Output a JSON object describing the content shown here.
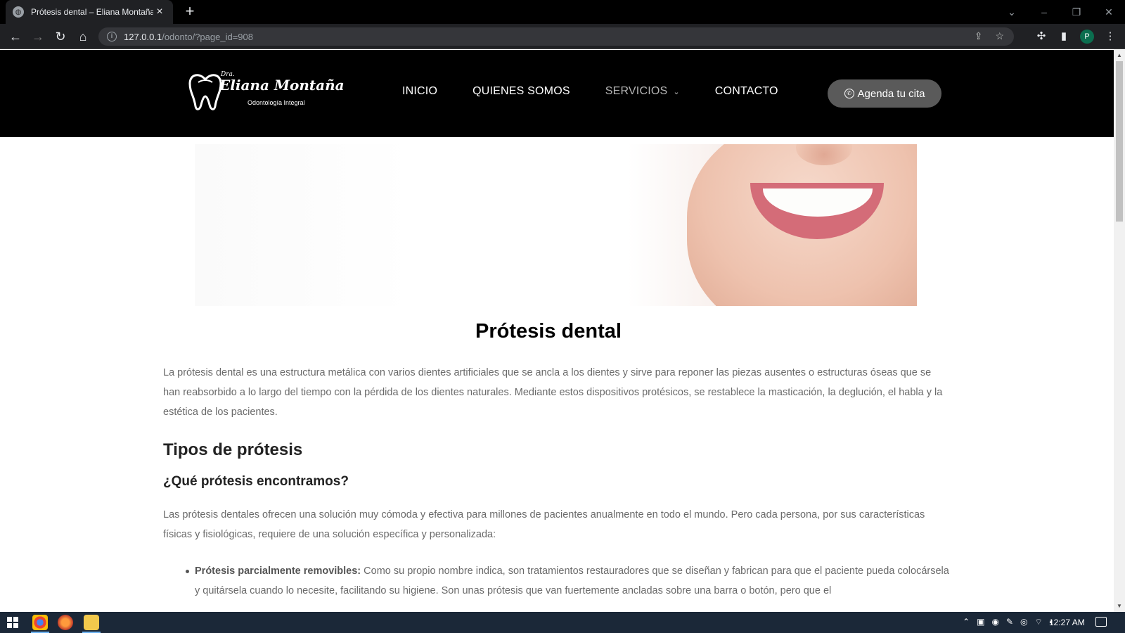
{
  "browser": {
    "tab_title": "Prótesis dental – Eliana Montaña",
    "url_host": "127.0.0.1",
    "url_path": "/odonto/?page_id=908",
    "profile_initial": "P"
  },
  "site": {
    "logo": {
      "prefix": "Dra.",
      "name": "Eliana Montaña",
      "subtitle": "Odontología Integral"
    },
    "nav": {
      "inicio": "INICIO",
      "quienes": "QUIENES SOMOS",
      "servicios": "SERVICIOS",
      "contacto": "CONTACTO"
    },
    "cta_label": "Agenda tu cita"
  },
  "page": {
    "title": "Prótesis dental",
    "intro": "La prótesis dental es una estructura metálica con varios dientes artificiales que se ancla a los dientes y sirve para reponer las piezas ausentes o estructuras óseas que se han reabsorbido a lo largo del tiempo con la pérdida de los dientes naturales. Mediante estos dispositivos protésicos, se restablece la masticación, la deglución, el habla y la estética de los pacientes.",
    "h2": "Tipos de prótesis",
    "h3": "¿Qué prótesis encontramos?",
    "para2": "Las prótesis dentales ofrecen una solución muy cómoda y efectiva para millones de pacientes anualmente en todo el mundo. Pero cada persona, por sus características físicas y fisiológicas, requiere de una solución específica y personalizada:",
    "bullets": [
      {
        "term": "Prótesis parcialmente removibles:",
        "text": " Como su propio nombre indica, son tratamientos restauradores que se diseñan y fabrican para que el paciente pueda colocársela y quitársela cuando lo necesite, facilitando su higiene. Son unas prótesis que van fuertemente ancladas sobre una barra o botón, pero que el"
      }
    ]
  },
  "taskbar": {
    "clock": "12:27 AM"
  },
  "colors": {
    "header_bg": "#000000",
    "cta_bg": "#5a5a5a",
    "body_text": "#6a6a6a"
  }
}
